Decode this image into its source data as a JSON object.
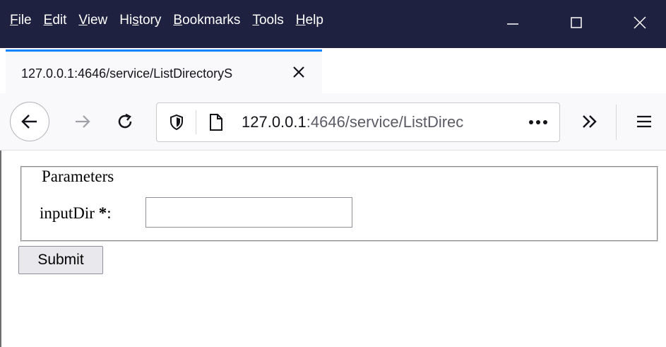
{
  "menu": [
    {
      "label": "File",
      "accel": "F",
      "rest": "ile"
    },
    {
      "label": "Edit",
      "accel": "E",
      "rest": "dit"
    },
    {
      "label": "View",
      "accel": "V",
      "rest": "iew"
    },
    {
      "label": "History",
      "pre": "Hi",
      "accel": "s",
      "rest": "tory"
    },
    {
      "label": "Bookmarks",
      "accel": "B",
      "rest": "ookmarks"
    },
    {
      "label": "Tools",
      "accel": "T",
      "rest": "ools"
    },
    {
      "label": "Help",
      "accel": "H",
      "rest": "elp"
    }
  ],
  "tab": {
    "title": "127.0.0.1:4646/service/ListDirectoryS"
  },
  "url": {
    "host": "127.0.0.1",
    "path": ":4646/service/ListDirec"
  },
  "form": {
    "legend": "Parameters",
    "field_label": "inputDir",
    "required_mark": "*",
    "colon": ":",
    "input_value": "",
    "submit_label": "Submit"
  },
  "colors": {
    "titlebar": "#1f2141",
    "tab_accent": "#0a84ff",
    "toolbar": "#f9f9fb"
  },
  "icons": [
    "minimize-icon",
    "maximize-icon",
    "close-icon",
    "tab-close-icon",
    "new-tab-icon",
    "back-icon",
    "forward-icon",
    "reload-icon",
    "shield-icon",
    "page-icon",
    "more-actions-icon",
    "overflow-icon",
    "hamburger-menu-icon"
  ]
}
